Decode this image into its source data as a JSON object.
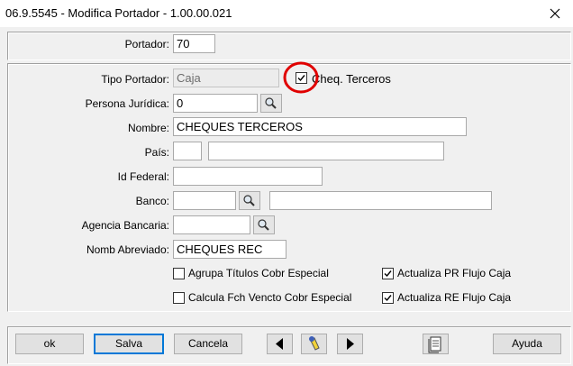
{
  "window": {
    "title": "06.9.5545 - Modifica Portador - 1.00.00.021"
  },
  "form": {
    "portador_label": "Portador:",
    "portador_value": "70",
    "tipo_portador_label": "Tipo Portador:",
    "tipo_portador_value": "Caja",
    "cheq_terceros_label": "Cheq. Terceros",
    "persona_juridica_label": "Persona Jurídica:",
    "persona_juridica_value": "0",
    "nombre_label": "Nombre:",
    "nombre_value": "CHEQUES TERCEROS",
    "pais_label": "País:",
    "pais_code": "",
    "pais_name": "",
    "id_federal_label": "Id Federal:",
    "id_federal_value": "",
    "banco_label": "Banco:",
    "banco_code": "",
    "banco_name": "",
    "agencia_label": "Agencia Bancaria:",
    "agencia_value": "",
    "nomb_abreviado_label": "Nomb Abreviado:",
    "nomb_abreviado_value": "CHEQUES REC",
    "checkboxes": {
      "agrupa_label": "Agrupa Títulos Cobr Especial",
      "agrupa_checked": false,
      "calcula_label": "Calcula Fch Vencto Cobr Especial",
      "calcula_checked": false,
      "act_pr_label": "Actualiza PR Flujo Caja",
      "act_pr_checked": true,
      "act_re_label": "Actualiza RE Flujo Caja",
      "act_re_checked": true,
      "cheq_terceros_checked": true
    }
  },
  "buttons": {
    "ok": "ok",
    "salva": "Salva",
    "cancela": "Cancela",
    "ayuda": "Ayuda"
  },
  "icons": [
    "close-icon",
    "search-icon",
    "arrow-left-icon",
    "flashlight-icon",
    "arrow-right-icon",
    "document-icon"
  ],
  "colors": {
    "highlight_circle": "#e00000",
    "default_button_border": "#0078d7"
  }
}
